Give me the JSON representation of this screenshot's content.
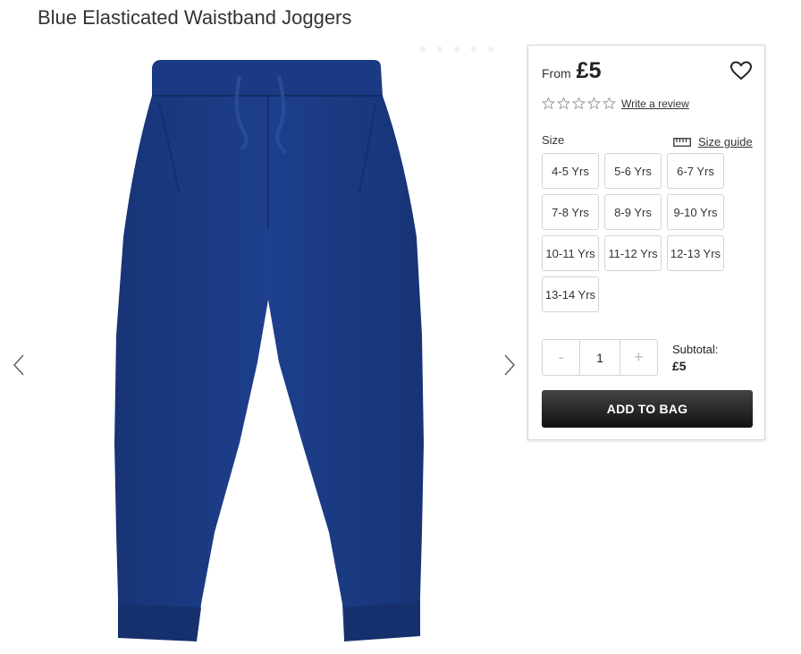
{
  "product": {
    "title": "Blue Elasticated Waistband Joggers"
  },
  "gallery": {
    "prev_icon": "chevron-left-icon",
    "next_icon": "chevron-right-icon",
    "image_color": "#1a3a80"
  },
  "panel": {
    "from_label": "From",
    "price": "£5",
    "wishlist_icon": "heart-icon",
    "review_link": "Write a review",
    "star_count": 5,
    "size_label": "Size",
    "size_guide_label": "Size guide",
    "size_guide_icon": "ruler-icon",
    "sizes": [
      "4-5 Yrs",
      "5-6 Yrs",
      "6-7 Yrs",
      "7-8 Yrs",
      "8-9 Yrs",
      "9-10 Yrs",
      "10-11 Yrs",
      "11-12 Yrs",
      "12-13 Yrs",
      "13-14 Yrs"
    ],
    "quantity": {
      "minus": "-",
      "value": "1",
      "plus": "+"
    },
    "subtotal_label": "Subtotal:",
    "subtotal_value": "£5",
    "add_button": "ADD TO BAG"
  }
}
